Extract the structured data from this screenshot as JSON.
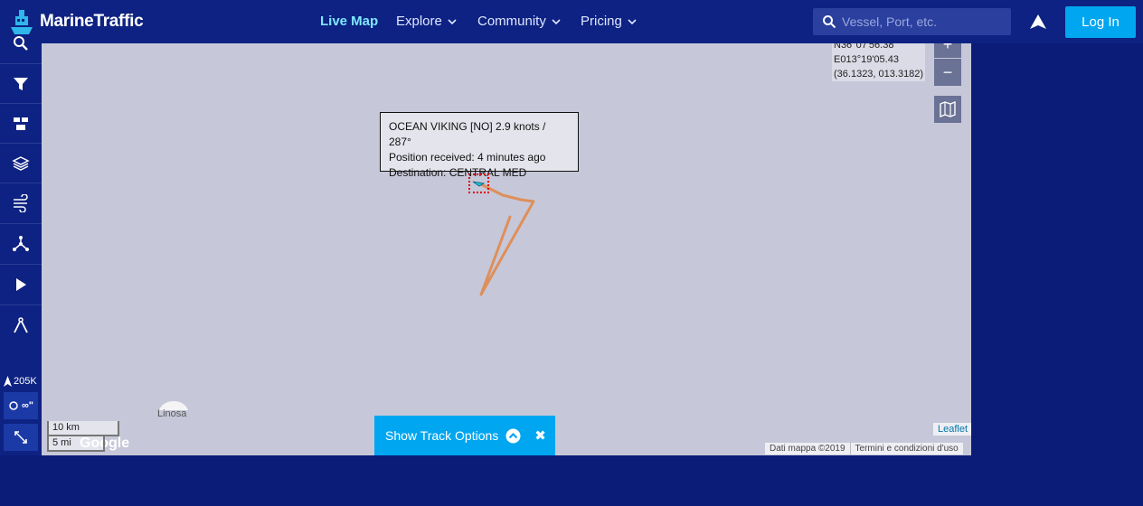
{
  "header": {
    "brand": "MarineTraffic",
    "nav": [
      {
        "label": "Live Map",
        "active": true,
        "dropdown": false
      },
      {
        "label": "Explore",
        "active": false,
        "dropdown": true
      },
      {
        "label": "Community",
        "active": false,
        "dropdown": true
      },
      {
        "label": "Pricing",
        "active": false,
        "dropdown": true
      }
    ],
    "search_placeholder": "Vessel, Port, etc.",
    "login_label": "Log In"
  },
  "sidebar": {
    "buttons": [
      "search-icon",
      "filter-icon",
      "fleet-icon",
      "layers-icon",
      "weather-icon",
      "route-icon",
      "play-icon",
      "measure-icon"
    ],
    "vessel_count": "205K",
    "toggle_label": "∞\""
  },
  "map": {
    "coords": {
      "lat": "N36°07'56.38",
      "lon": "E013°19'05.43",
      "decimal": "(36.1323, 013.3182)"
    },
    "zoom_in": "+",
    "zoom_out": "−",
    "tooltip": {
      "line1": "OCEAN VIKING [NO] 2.9 knots / 287°",
      "line2": "Position received: 4 minutes ago",
      "line3": "Destination: CENTRAL MED"
    },
    "island_label": "Linosa",
    "scale_km": "10 km",
    "scale_mi": "5 mi",
    "google_label": "Google",
    "leaflet_label": "Leaflet",
    "attribution": [
      "Dati mappa ©2019",
      "Termini e condizioni d'uso"
    ],
    "colors": {
      "track": "#e0884c",
      "vessel": "#1ec8e8",
      "marker": "#e00000"
    }
  },
  "track_options": {
    "label": "Show Track Options",
    "close": "✖"
  }
}
